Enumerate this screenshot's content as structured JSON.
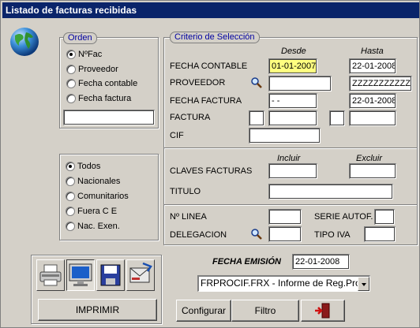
{
  "window": {
    "title": "Listado de facturas recibidas"
  },
  "orden": {
    "legend": "Orden",
    "options": [
      "NºFac",
      "Proveedor",
      "Fecha contable",
      "Fecha factura"
    ],
    "selected": 0,
    "text_value": ""
  },
  "tipo": {
    "options": [
      "Todos",
      "Nacionales",
      "Comunitarios",
      "Fuera C E",
      "Nac. Exen."
    ],
    "selected": 0
  },
  "criterio": {
    "legend": "Criterio de Selección",
    "desde_header": "Desde",
    "hasta_header": "Hasta",
    "fecha_contable": {
      "label": "FECHA CONTABLE",
      "desde": "01-01-2007",
      "hasta": "22-01-2008"
    },
    "proveedor": {
      "label": "PROVEEDOR",
      "desde": "",
      "hasta": "ZZZZZZZZZZZ"
    },
    "fecha_factura": {
      "label": "FECHA FACTURA",
      "desde": "  -  -",
      "hasta": "22-01-2008"
    },
    "factura": {
      "label": "FACTURA",
      "desde_serie": "",
      "desde": "",
      "hasta_serie": "",
      "hasta": ""
    },
    "cif": {
      "label": "CIF",
      "value": ""
    },
    "incluir_header": "Incluir",
    "excluir_header": "Excluir",
    "claves": {
      "label": "CLAVES FACTURAS",
      "incluir": "",
      "excluir": ""
    },
    "titulo": {
      "label": "TITULO",
      "value": ""
    },
    "n_linea": {
      "label": "Nº LINEA",
      "value": ""
    },
    "serie_autof": {
      "label": "SERIE AUTOF.",
      "value": ""
    },
    "delegacion": {
      "label": "DELEGACION",
      "value": ""
    },
    "tipo_iva": {
      "label": "TIPO IVA",
      "value": ""
    }
  },
  "emision": {
    "label": "FECHA EMISIÓN",
    "value": "22-01-2008"
  },
  "report": {
    "selected": "FRPROCIF.FRX - Informe de Reg.Prov."
  },
  "buttons": {
    "imprimir": "IMPRIMIR",
    "configurar": "Configurar",
    "filtro": "Filtro"
  },
  "icons": {
    "output": [
      "printer-icon",
      "monitor-icon",
      "floppy-disk-icon",
      "email-icon"
    ],
    "exit": "exit-door-icon",
    "search": "magnifier-icon",
    "globe": "globe-icon"
  },
  "colors": {
    "titlebar": "#0a246a",
    "legend_text": "#0000a0",
    "highlight_field": "#ffff80"
  }
}
